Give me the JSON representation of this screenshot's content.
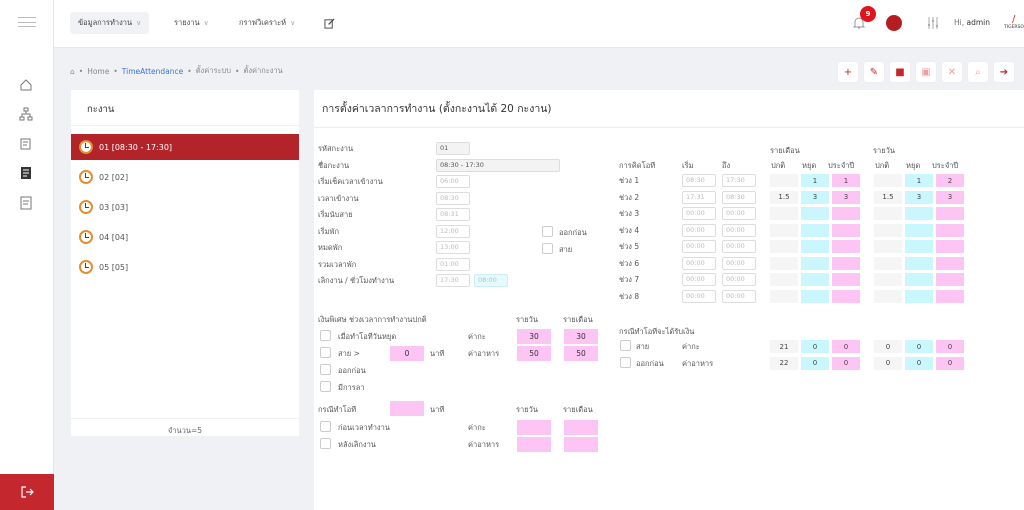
{
  "menu": [
    {
      "label": "ข้อมูลการทำงาน",
      "active": true
    },
    {
      "label": "รายงาน"
    },
    {
      "label": "กราฟวิเคราะห์"
    }
  ],
  "notif_count": "9",
  "user": {
    "greeting": "Hi,",
    "name": "admin",
    "logo": "TIGERSOFT"
  },
  "breadcrumb": {
    "home": "Home",
    "section": "TimeAttendance",
    "p1": "ตั้งค่าระบบ",
    "p2": "ตั้งค่ากะงาน"
  },
  "left": {
    "title": "กะงาน",
    "shifts": [
      "01 [08:30 - 17:30]",
      "02 [02]",
      "03 [03]",
      "04 [04]",
      "05 [05]"
    ],
    "count": "จำนวน=5"
  },
  "right": {
    "title": "การตั้งค่าเวลาการทำงาน (ตั้งกะงานได้ 20 กะงาน)",
    "form": [
      {
        "label": "รหัสกะงาน",
        "value": "01"
      },
      {
        "label": "ชื่อกะงาน",
        "value": "08:30 - 17:30"
      },
      {
        "label": "เริ่มเช็คเวลาเข้างาน",
        "value": "06:00"
      },
      {
        "label": "เวลาเข้างาน",
        "value": "08:30"
      },
      {
        "label": "เริ่มนับสาย",
        "value": "08:31"
      },
      {
        "label": "เริ่มพัก",
        "value": "12:00"
      },
      {
        "label": "หมดพัก",
        "value": "13:00"
      },
      {
        "label": "รวมเวลาพัก",
        "value": "01:00"
      },
      {
        "label": "เลิกงาน / ชั่วโมงทำงาน",
        "value": "17:30",
        "value2": "08:00"
      }
    ],
    "early_label": "ออกก่อน",
    "late_label": "สาย",
    "ot": {
      "heading": "การคิดโอที",
      "start": "เริ่ม",
      "end": "ถึง",
      "monthly": "รายเดือน",
      "daily": "รายวัน",
      "col_normal": "ปกติ",
      "col_holiday": "หยุด",
      "col_fixed": "ประจำปี",
      "rows": [
        {
          "label": "ช่วง 1",
          "start": "08:30",
          "end": "17:30",
          "m": [
            "",
            "1",
            "1"
          ],
          "d": [
            "",
            "1",
            "2"
          ]
        },
        {
          "label": "ช่วง 2",
          "start": "17:31",
          "end": "08:30",
          "m": [
            "1.5",
            "3",
            "3"
          ],
          "d": [
            "1.5",
            "3",
            "3"
          ]
        },
        {
          "label": "ช่วง 3",
          "start": "00:00",
          "end": "00:00",
          "m": [
            "",
            "",
            ""
          ],
          "d": [
            "",
            "",
            ""
          ]
        },
        {
          "label": "ช่วง 4",
          "start": "00:00",
          "end": "00:00",
          "m": [
            "",
            "",
            ""
          ],
          "d": [
            "",
            "",
            ""
          ]
        },
        {
          "label": "ช่วง 5",
          "start": "00:00",
          "end": "00:00",
          "m": [
            "",
            "",
            ""
          ],
          "d": [
            "",
            "",
            ""
          ]
        },
        {
          "label": "ช่วง 6",
          "start": "00:00",
          "end": "00:00",
          "m": [
            "",
            "",
            ""
          ],
          "d": [
            "",
            "",
            ""
          ]
        },
        {
          "label": "ช่วง 7",
          "start": "00:00",
          "end": "00:00",
          "m": [
            "",
            "",
            ""
          ],
          "d": [
            "",
            "",
            ""
          ]
        },
        {
          "label": "ช่วง 8",
          "start": "00:00",
          "end": "00:00",
          "m": [
            "",
            "",
            ""
          ],
          "d": [
            "",
            "",
            ""
          ]
        }
      ]
    },
    "bonus": {
      "heading": "เงินพิเศษ ช่วงเวลาการทำงานปกติ",
      "daily": "รายวัน",
      "monthly": "รายเดือน",
      "opt1": "เมื่อทำโอทีวันหยุด",
      "opt2": "สาย >",
      "opt2_value": "0",
      "opt2_unit": "นาที",
      "opt3": "ออกก่อน",
      "opt4": "มีการลา",
      "shift_fee": "ค่ากะ",
      "food_fee": "ค่าอาหาร",
      "shift_daily": "30",
      "shift_monthly": "30",
      "food_daily": "50",
      "food_monthly": "50"
    },
    "otcase": {
      "heading": "กรณีทำโอที",
      "unit": "นาที",
      "daily": "รายวัน",
      "monthly": "รายเดือน",
      "opt1": "ก่อนเวลาทำงาน",
      "opt2": "หลังเลิกงาน",
      "shift_fee": "ค่ากะ",
      "food_fee": "ค่าอาหาร"
    },
    "pay": {
      "heading": "กรณีทำโอทีจะได้รับเงิน",
      "rows": [
        {
          "label": "สาย",
          "fee": "ค่ากะ",
          "m": [
            "21",
            "0",
            "0"
          ],
          "d": [
            "0",
            "0",
            "0"
          ]
        },
        {
          "label": "ออกก่อน",
          "fee": "ค่าอาหาร",
          "m": [
            "22",
            "0",
            "0"
          ],
          "d": [
            "0",
            "0",
            "0"
          ]
        }
      ]
    }
  },
  "colors": {
    "brand": "#b3232a",
    "cyan": "#c9f7fd",
    "pink": "#fdc5f3"
  }
}
